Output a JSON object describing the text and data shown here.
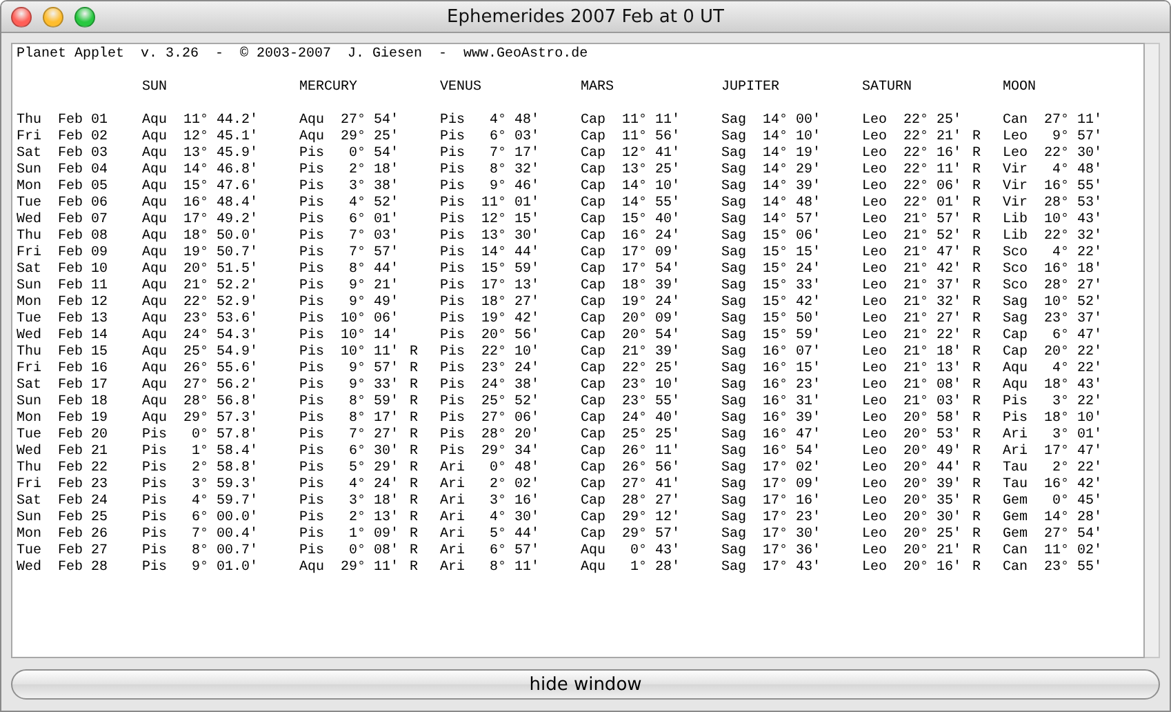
{
  "window": {
    "title": "Ephemerides 2007 Feb at 0 UT"
  },
  "applet_header": "Planet Applet  v. 3.26  -  © 2003-2007  J. Giesen  -  www.GeoAstro.de",
  "columns": [
    "SUN",
    "MERCURY",
    "VENUS",
    "MARS",
    "JUPITER",
    "SATURN",
    "MOON"
  ],
  "rows": [
    {
      "day": "Thu",
      "date": "Feb 01",
      "cells": [
        [
          "Aqu",
          "11° 44.2'"
        ],
        [
          "Aqu",
          "27° 54'"
        ],
        [
          "Pis",
          "4° 48'"
        ],
        [
          "Cap",
          "11° 11'"
        ],
        [
          "Sag",
          "14° 00'"
        ],
        [
          "Leo",
          "22° 25'"
        ],
        [
          "Can",
          "27° 11'"
        ]
      ]
    },
    {
      "day": "Fri",
      "date": "Feb 02",
      "cells": [
        [
          "Aqu",
          "12° 45.1'"
        ],
        [
          "Aqu",
          "29° 25'"
        ],
        [
          "Pis",
          "6° 03'"
        ],
        [
          "Cap",
          "11° 56'"
        ],
        [
          "Sag",
          "14° 10'"
        ],
        [
          "Leo",
          "22° 21'",
          "R"
        ],
        [
          "Leo",
          "9° 57'"
        ]
      ]
    },
    {
      "day": "Sat",
      "date": "Feb 03",
      "cells": [
        [
          "Aqu",
          "13° 45.9'"
        ],
        [
          "Pis",
          "0° 54'"
        ],
        [
          "Pis",
          "7° 17'"
        ],
        [
          "Cap",
          "12° 41'"
        ],
        [
          "Sag",
          "14° 19'"
        ],
        [
          "Leo",
          "22° 16'",
          "R"
        ],
        [
          "Leo",
          "22° 30'"
        ]
      ]
    },
    {
      "day": "Sun",
      "date": "Feb 04",
      "cells": [
        [
          "Aqu",
          "14° 46.8'"
        ],
        [
          "Pis",
          "2° 18'"
        ],
        [
          "Pis",
          "8° 32'"
        ],
        [
          "Cap",
          "13° 25'"
        ],
        [
          "Sag",
          "14° 29'"
        ],
        [
          "Leo",
          "22° 11'",
          "R"
        ],
        [
          "Vir",
          "4° 48'"
        ]
      ]
    },
    {
      "day": "Mon",
      "date": "Feb 05",
      "cells": [
        [
          "Aqu",
          "15° 47.6'"
        ],
        [
          "Pis",
          "3° 38'"
        ],
        [
          "Pis",
          "9° 46'"
        ],
        [
          "Cap",
          "14° 10'"
        ],
        [
          "Sag",
          "14° 39'"
        ],
        [
          "Leo",
          "22° 06'",
          "R"
        ],
        [
          "Vir",
          "16° 55'"
        ]
      ]
    },
    {
      "day": "Tue",
      "date": "Feb 06",
      "cells": [
        [
          "Aqu",
          "16° 48.4'"
        ],
        [
          "Pis",
          "4° 52'"
        ],
        [
          "Pis",
          "11° 01'"
        ],
        [
          "Cap",
          "14° 55'"
        ],
        [
          "Sag",
          "14° 48'"
        ],
        [
          "Leo",
          "22° 01'",
          "R"
        ],
        [
          "Vir",
          "28° 53'"
        ]
      ]
    },
    {
      "day": "Wed",
      "date": "Feb 07",
      "cells": [
        [
          "Aqu",
          "17° 49.2'"
        ],
        [
          "Pis",
          "6° 01'"
        ],
        [
          "Pis",
          "12° 15'"
        ],
        [
          "Cap",
          "15° 40'"
        ],
        [
          "Sag",
          "14° 57'"
        ],
        [
          "Leo",
          "21° 57'",
          "R"
        ],
        [
          "Lib",
          "10° 43'"
        ]
      ]
    },
    {
      "day": "Thu",
      "date": "Feb 08",
      "cells": [
        [
          "Aqu",
          "18° 50.0'"
        ],
        [
          "Pis",
          "7° 03'"
        ],
        [
          "Pis",
          "13° 30'"
        ],
        [
          "Cap",
          "16° 24'"
        ],
        [
          "Sag",
          "15° 06'"
        ],
        [
          "Leo",
          "21° 52'",
          "R"
        ],
        [
          "Lib",
          "22° 32'"
        ]
      ]
    },
    {
      "day": "Fri",
      "date": "Feb 09",
      "cells": [
        [
          "Aqu",
          "19° 50.7'"
        ],
        [
          "Pis",
          "7° 57'"
        ],
        [
          "Pis",
          "14° 44'"
        ],
        [
          "Cap",
          "17° 09'"
        ],
        [
          "Sag",
          "15° 15'"
        ],
        [
          "Leo",
          "21° 47'",
          "R"
        ],
        [
          "Sco",
          "4° 22'"
        ]
      ]
    },
    {
      "day": "Sat",
      "date": "Feb 10",
      "cells": [
        [
          "Aqu",
          "20° 51.5'"
        ],
        [
          "Pis",
          "8° 44'"
        ],
        [
          "Pis",
          "15° 59'"
        ],
        [
          "Cap",
          "17° 54'"
        ],
        [
          "Sag",
          "15° 24'"
        ],
        [
          "Leo",
          "21° 42'",
          "R"
        ],
        [
          "Sco",
          "16° 18'"
        ]
      ]
    },
    {
      "day": "Sun",
      "date": "Feb 11",
      "cells": [
        [
          "Aqu",
          "21° 52.2'"
        ],
        [
          "Pis",
          "9° 21'"
        ],
        [
          "Pis",
          "17° 13'"
        ],
        [
          "Cap",
          "18° 39'"
        ],
        [
          "Sag",
          "15° 33'"
        ],
        [
          "Leo",
          "21° 37'",
          "R"
        ],
        [
          "Sco",
          "28° 27'"
        ]
      ]
    },
    {
      "day": "Mon",
      "date": "Feb 12",
      "cells": [
        [
          "Aqu",
          "22° 52.9'"
        ],
        [
          "Pis",
          "9° 49'"
        ],
        [
          "Pis",
          "18° 27'"
        ],
        [
          "Cap",
          "19° 24'"
        ],
        [
          "Sag",
          "15° 42'"
        ],
        [
          "Leo",
          "21° 32'",
          "R"
        ],
        [
          "Sag",
          "10° 52'"
        ]
      ]
    },
    {
      "day": "Tue",
      "date": "Feb 13",
      "cells": [
        [
          "Aqu",
          "23° 53.6'"
        ],
        [
          "Pis",
          "10° 06'"
        ],
        [
          "Pis",
          "19° 42'"
        ],
        [
          "Cap",
          "20° 09'"
        ],
        [
          "Sag",
          "15° 50'"
        ],
        [
          "Leo",
          "21° 27'",
          "R"
        ],
        [
          "Sag",
          "23° 37'"
        ]
      ]
    },
    {
      "day": "Wed",
      "date": "Feb 14",
      "cells": [
        [
          "Aqu",
          "24° 54.3'"
        ],
        [
          "Pis",
          "10° 14'"
        ],
        [
          "Pis",
          "20° 56'"
        ],
        [
          "Cap",
          "20° 54'"
        ],
        [
          "Sag",
          "15° 59'"
        ],
        [
          "Leo",
          "21° 22'",
          "R"
        ],
        [
          "Cap",
          "6° 47'"
        ]
      ]
    },
    {
      "day": "Thu",
      "date": "Feb 15",
      "cells": [
        [
          "Aqu",
          "25° 54.9'"
        ],
        [
          "Pis",
          "10° 11'",
          "R"
        ],
        [
          "Pis",
          "22° 10'"
        ],
        [
          "Cap",
          "21° 39'"
        ],
        [
          "Sag",
          "16° 07'"
        ],
        [
          "Leo",
          "21° 18'",
          "R"
        ],
        [
          "Cap",
          "20° 22'"
        ]
      ]
    },
    {
      "day": "Fri",
      "date": "Feb 16",
      "cells": [
        [
          "Aqu",
          "26° 55.6'"
        ],
        [
          "Pis",
          "9° 57'",
          "R"
        ],
        [
          "Pis",
          "23° 24'"
        ],
        [
          "Cap",
          "22° 25'"
        ],
        [
          "Sag",
          "16° 15'"
        ],
        [
          "Leo",
          "21° 13'",
          "R"
        ],
        [
          "Aqu",
          "4° 22'"
        ]
      ]
    },
    {
      "day": "Sat",
      "date": "Feb 17",
      "cells": [
        [
          "Aqu",
          "27° 56.2'"
        ],
        [
          "Pis",
          "9° 33'",
          "R"
        ],
        [
          "Pis",
          "24° 38'"
        ],
        [
          "Cap",
          "23° 10'"
        ],
        [
          "Sag",
          "16° 23'"
        ],
        [
          "Leo",
          "21° 08'",
          "R"
        ],
        [
          "Aqu",
          "18° 43'"
        ]
      ]
    },
    {
      "day": "Sun",
      "date": "Feb 18",
      "cells": [
        [
          "Aqu",
          "28° 56.8'"
        ],
        [
          "Pis",
          "8° 59'",
          "R"
        ],
        [
          "Pis",
          "25° 52'"
        ],
        [
          "Cap",
          "23° 55'"
        ],
        [
          "Sag",
          "16° 31'"
        ],
        [
          "Leo",
          "21° 03'",
          "R"
        ],
        [
          "Pis",
          "3° 22'"
        ]
      ]
    },
    {
      "day": "Mon",
      "date": "Feb 19",
      "cells": [
        [
          "Aqu",
          "29° 57.3'"
        ],
        [
          "Pis",
          "8° 17'",
          "R"
        ],
        [
          "Pis",
          "27° 06'"
        ],
        [
          "Cap",
          "24° 40'"
        ],
        [
          "Sag",
          "16° 39'"
        ],
        [
          "Leo",
          "20° 58'",
          "R"
        ],
        [
          "Pis",
          "18° 10'"
        ]
      ]
    },
    {
      "day": "Tue",
      "date": "Feb 20",
      "cells": [
        [
          "Pis",
          "0° 57.8'"
        ],
        [
          "Pis",
          "7° 27'",
          "R"
        ],
        [
          "Pis",
          "28° 20'"
        ],
        [
          "Cap",
          "25° 25'"
        ],
        [
          "Sag",
          "16° 47'"
        ],
        [
          "Leo",
          "20° 53'",
          "R"
        ],
        [
          "Ari",
          "3° 01'"
        ]
      ]
    },
    {
      "day": "Wed",
      "date": "Feb 21",
      "cells": [
        [
          "Pis",
          "1° 58.4'"
        ],
        [
          "Pis",
          "6° 30'",
          "R"
        ],
        [
          "Pis",
          "29° 34'"
        ],
        [
          "Cap",
          "26° 11'"
        ],
        [
          "Sag",
          "16° 54'"
        ],
        [
          "Leo",
          "20° 49'",
          "R"
        ],
        [
          "Ari",
          "17° 47'"
        ]
      ]
    },
    {
      "day": "Thu",
      "date": "Feb 22",
      "cells": [
        [
          "Pis",
          "2° 58.8'"
        ],
        [
          "Pis",
          "5° 29'",
          "R"
        ],
        [
          "Ari",
          "0° 48'"
        ],
        [
          "Cap",
          "26° 56'"
        ],
        [
          "Sag",
          "17° 02'"
        ],
        [
          "Leo",
          "20° 44'",
          "R"
        ],
        [
          "Tau",
          "2° 22'"
        ]
      ]
    },
    {
      "day": "Fri",
      "date": "Feb 23",
      "cells": [
        [
          "Pis",
          "3° 59.3'"
        ],
        [
          "Pis",
          "4° 24'",
          "R"
        ],
        [
          "Ari",
          "2° 02'"
        ],
        [
          "Cap",
          "27° 41'"
        ],
        [
          "Sag",
          "17° 09'"
        ],
        [
          "Leo",
          "20° 39'",
          "R"
        ],
        [
          "Tau",
          "16° 42'"
        ]
      ]
    },
    {
      "day": "Sat",
      "date": "Feb 24",
      "cells": [
        [
          "Pis",
          "4° 59.7'"
        ],
        [
          "Pis",
          "3° 18'",
          "R"
        ],
        [
          "Ari",
          "3° 16'"
        ],
        [
          "Cap",
          "28° 27'"
        ],
        [
          "Sag",
          "17° 16'"
        ],
        [
          "Leo",
          "20° 35'",
          "R"
        ],
        [
          "Gem",
          "0° 45'"
        ]
      ]
    },
    {
      "day": "Sun",
      "date": "Feb 25",
      "cells": [
        [
          "Pis",
          "6° 00.0'"
        ],
        [
          "Pis",
          "2° 13'",
          "R"
        ],
        [
          "Ari",
          "4° 30'"
        ],
        [
          "Cap",
          "29° 12'"
        ],
        [
          "Sag",
          "17° 23'"
        ],
        [
          "Leo",
          "20° 30'",
          "R"
        ],
        [
          "Gem",
          "14° 28'"
        ]
      ]
    },
    {
      "day": "Mon",
      "date": "Feb 26",
      "cells": [
        [
          "Pis",
          "7° 00.4'"
        ],
        [
          "Pis",
          "1° 09'",
          "R"
        ],
        [
          "Ari",
          "5° 44'"
        ],
        [
          "Cap",
          "29° 57'"
        ],
        [
          "Sag",
          "17° 30'"
        ],
        [
          "Leo",
          "20° 25'",
          "R"
        ],
        [
          "Gem",
          "27° 54'"
        ]
      ]
    },
    {
      "day": "Tue",
      "date": "Feb 27",
      "cells": [
        [
          "Pis",
          "8° 00.7'"
        ],
        [
          "Pis",
          "0° 08'",
          "R"
        ],
        [
          "Ari",
          "6° 57'"
        ],
        [
          "Aqu",
          "0° 43'"
        ],
        [
          "Sag",
          "17° 36'"
        ],
        [
          "Leo",
          "20° 21'",
          "R"
        ],
        [
          "Can",
          "11° 02'"
        ]
      ]
    },
    {
      "day": "Wed",
      "date": "Feb 28",
      "cells": [
        [
          "Pis",
          "9° 01.0'"
        ],
        [
          "Aqu",
          "29° 11'",
          "R"
        ],
        [
          "Ari",
          "8° 11'"
        ],
        [
          "Aqu",
          "1° 28'"
        ],
        [
          "Sag",
          "17° 43'"
        ],
        [
          "Leo",
          "20° 16'",
          "R"
        ],
        [
          "Can",
          "23° 55'"
        ]
      ]
    }
  ],
  "footer_button": "hide window"
}
